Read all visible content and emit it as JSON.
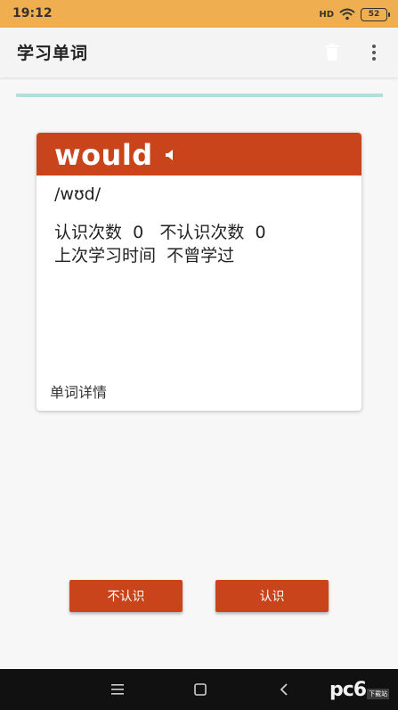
{
  "status_bar": {
    "time": "19:12",
    "signal": "HD",
    "battery": "52"
  },
  "app_bar": {
    "title": "学习单词",
    "trash_icon": "trash-icon",
    "more_icon": "more-vert-icon"
  },
  "card": {
    "word": "would",
    "speaker_icon": "speaker-icon",
    "phonetic": "/wʊd/",
    "known_label": "认识次数",
    "known_count": "0",
    "unknown_label": "不认识次数",
    "unknown_count": "0",
    "last_study_label": "上次学习时间",
    "last_study_value": "不曾学过",
    "detail_link": "单词详情"
  },
  "buttons": {
    "unknown": "不认识",
    "known": "认识"
  },
  "nav_bar": {
    "menu_icon": "menu-icon",
    "home_icon": "home-icon",
    "back_icon": "back-icon"
  },
  "watermark": {
    "text": "pc6",
    "badge": "下载站"
  },
  "colors": {
    "status_bar": "#efae4f",
    "accent": "#c9441b",
    "progress": "#b2dfdb",
    "nav_bar": "#111111"
  }
}
